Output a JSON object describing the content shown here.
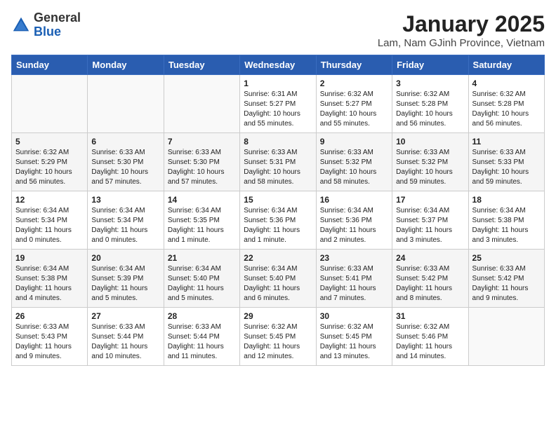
{
  "header": {
    "logo_general": "General",
    "logo_blue": "Blue",
    "month": "January 2025",
    "location": "Lam, Nam GJinh Province, Vietnam"
  },
  "weekdays": [
    "Sunday",
    "Monday",
    "Tuesday",
    "Wednesday",
    "Thursday",
    "Friday",
    "Saturday"
  ],
  "weeks": [
    [
      {
        "day": "",
        "info": ""
      },
      {
        "day": "",
        "info": ""
      },
      {
        "day": "",
        "info": ""
      },
      {
        "day": "1",
        "info": "Sunrise: 6:31 AM\nSunset: 5:27 PM\nDaylight: 10 hours\nand 55 minutes."
      },
      {
        "day": "2",
        "info": "Sunrise: 6:32 AM\nSunset: 5:27 PM\nDaylight: 10 hours\nand 55 minutes."
      },
      {
        "day": "3",
        "info": "Sunrise: 6:32 AM\nSunset: 5:28 PM\nDaylight: 10 hours\nand 56 minutes."
      },
      {
        "day": "4",
        "info": "Sunrise: 6:32 AM\nSunset: 5:28 PM\nDaylight: 10 hours\nand 56 minutes."
      }
    ],
    [
      {
        "day": "5",
        "info": "Sunrise: 6:32 AM\nSunset: 5:29 PM\nDaylight: 10 hours\nand 56 minutes."
      },
      {
        "day": "6",
        "info": "Sunrise: 6:33 AM\nSunset: 5:30 PM\nDaylight: 10 hours\nand 57 minutes."
      },
      {
        "day": "7",
        "info": "Sunrise: 6:33 AM\nSunset: 5:30 PM\nDaylight: 10 hours\nand 57 minutes."
      },
      {
        "day": "8",
        "info": "Sunrise: 6:33 AM\nSunset: 5:31 PM\nDaylight: 10 hours\nand 58 minutes."
      },
      {
        "day": "9",
        "info": "Sunrise: 6:33 AM\nSunset: 5:32 PM\nDaylight: 10 hours\nand 58 minutes."
      },
      {
        "day": "10",
        "info": "Sunrise: 6:33 AM\nSunset: 5:32 PM\nDaylight: 10 hours\nand 59 minutes."
      },
      {
        "day": "11",
        "info": "Sunrise: 6:33 AM\nSunset: 5:33 PM\nDaylight: 10 hours\nand 59 minutes."
      }
    ],
    [
      {
        "day": "12",
        "info": "Sunrise: 6:34 AM\nSunset: 5:34 PM\nDaylight: 11 hours\nand 0 minutes."
      },
      {
        "day": "13",
        "info": "Sunrise: 6:34 AM\nSunset: 5:34 PM\nDaylight: 11 hours\nand 0 minutes."
      },
      {
        "day": "14",
        "info": "Sunrise: 6:34 AM\nSunset: 5:35 PM\nDaylight: 11 hours\nand 1 minute."
      },
      {
        "day": "15",
        "info": "Sunrise: 6:34 AM\nSunset: 5:36 PM\nDaylight: 11 hours\nand 1 minute."
      },
      {
        "day": "16",
        "info": "Sunrise: 6:34 AM\nSunset: 5:36 PM\nDaylight: 11 hours\nand 2 minutes."
      },
      {
        "day": "17",
        "info": "Sunrise: 6:34 AM\nSunset: 5:37 PM\nDaylight: 11 hours\nand 3 minutes."
      },
      {
        "day": "18",
        "info": "Sunrise: 6:34 AM\nSunset: 5:38 PM\nDaylight: 11 hours\nand 3 minutes."
      }
    ],
    [
      {
        "day": "19",
        "info": "Sunrise: 6:34 AM\nSunset: 5:38 PM\nDaylight: 11 hours\nand 4 minutes."
      },
      {
        "day": "20",
        "info": "Sunrise: 6:34 AM\nSunset: 5:39 PM\nDaylight: 11 hours\nand 5 minutes."
      },
      {
        "day": "21",
        "info": "Sunrise: 6:34 AM\nSunset: 5:40 PM\nDaylight: 11 hours\nand 5 minutes."
      },
      {
        "day": "22",
        "info": "Sunrise: 6:34 AM\nSunset: 5:40 PM\nDaylight: 11 hours\nand 6 minutes."
      },
      {
        "day": "23",
        "info": "Sunrise: 6:33 AM\nSunset: 5:41 PM\nDaylight: 11 hours\nand 7 minutes."
      },
      {
        "day": "24",
        "info": "Sunrise: 6:33 AM\nSunset: 5:42 PM\nDaylight: 11 hours\nand 8 minutes."
      },
      {
        "day": "25",
        "info": "Sunrise: 6:33 AM\nSunset: 5:42 PM\nDaylight: 11 hours\nand 9 minutes."
      }
    ],
    [
      {
        "day": "26",
        "info": "Sunrise: 6:33 AM\nSunset: 5:43 PM\nDaylight: 11 hours\nand 9 minutes."
      },
      {
        "day": "27",
        "info": "Sunrise: 6:33 AM\nSunset: 5:44 PM\nDaylight: 11 hours\nand 10 minutes."
      },
      {
        "day": "28",
        "info": "Sunrise: 6:33 AM\nSunset: 5:44 PM\nDaylight: 11 hours\nand 11 minutes."
      },
      {
        "day": "29",
        "info": "Sunrise: 6:32 AM\nSunset: 5:45 PM\nDaylight: 11 hours\nand 12 minutes."
      },
      {
        "day": "30",
        "info": "Sunrise: 6:32 AM\nSunset: 5:45 PM\nDaylight: 11 hours\nand 13 minutes."
      },
      {
        "day": "31",
        "info": "Sunrise: 6:32 AM\nSunset: 5:46 PM\nDaylight: 11 hours\nand 14 minutes."
      },
      {
        "day": "",
        "info": ""
      }
    ]
  ]
}
